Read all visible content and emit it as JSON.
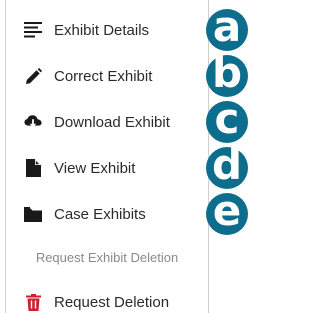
{
  "menu": {
    "items": [
      {
        "label": "Exhibit Details",
        "icon": "list-details-icon"
      },
      {
        "label": "Correct Exhibit",
        "icon": "pencil-icon"
      },
      {
        "label": "Download Exhibit",
        "icon": "cloud-download-icon"
      },
      {
        "label": "View Exhibit",
        "icon": "document-icon"
      },
      {
        "label": "Case Exhibits",
        "icon": "folder-icon"
      }
    ],
    "section_header": "Request Exhibit Deletion",
    "delete_item": {
      "label": "Request Deletion",
      "icon": "trash-icon",
      "icon_color": "#d11f2d"
    }
  },
  "badges": [
    "a",
    "b",
    "c",
    "d",
    "e"
  ],
  "colors": {
    "badge": "#0c6d8c",
    "text": "#2b2b2b",
    "muted_text": "#8a8a8a",
    "icon": "#1a1a1a",
    "danger": "#d11f2d"
  }
}
